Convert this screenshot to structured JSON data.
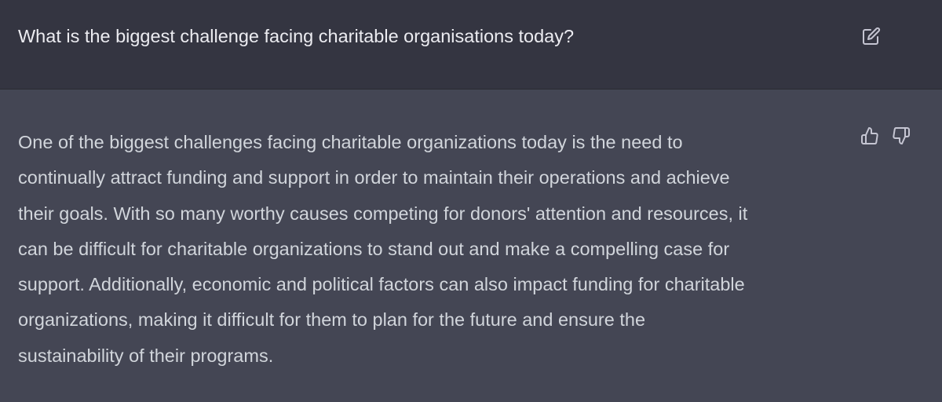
{
  "user_message": {
    "text": "What is the biggest challenge facing charitable organisations today?",
    "edit_icon": "edit-icon"
  },
  "assistant_message": {
    "lines": [
      "One of the biggest challenges facing charitable organizations today is the need to",
      "continually attract funding and support in order to maintain their operations and achieve",
      "their goals. With so many worthy causes competing for donors' attention and resources, it",
      "can be difficult for charitable organizations to stand out and make a compelling case for",
      "support. Additionally, economic and political factors can also impact funding for charitable",
      "organizations, making it difficult for them to plan for the future and ensure the",
      "sustainability of their programs."
    ],
    "icons": [
      "thumbs-up-icon",
      "thumbs-down-icon"
    ]
  },
  "colors": {
    "user_bg": "#343541",
    "assistant_bg": "#444654",
    "user_text": "#ececf1",
    "assistant_text": "#d1d5db",
    "icon": "#c5c5d2"
  }
}
